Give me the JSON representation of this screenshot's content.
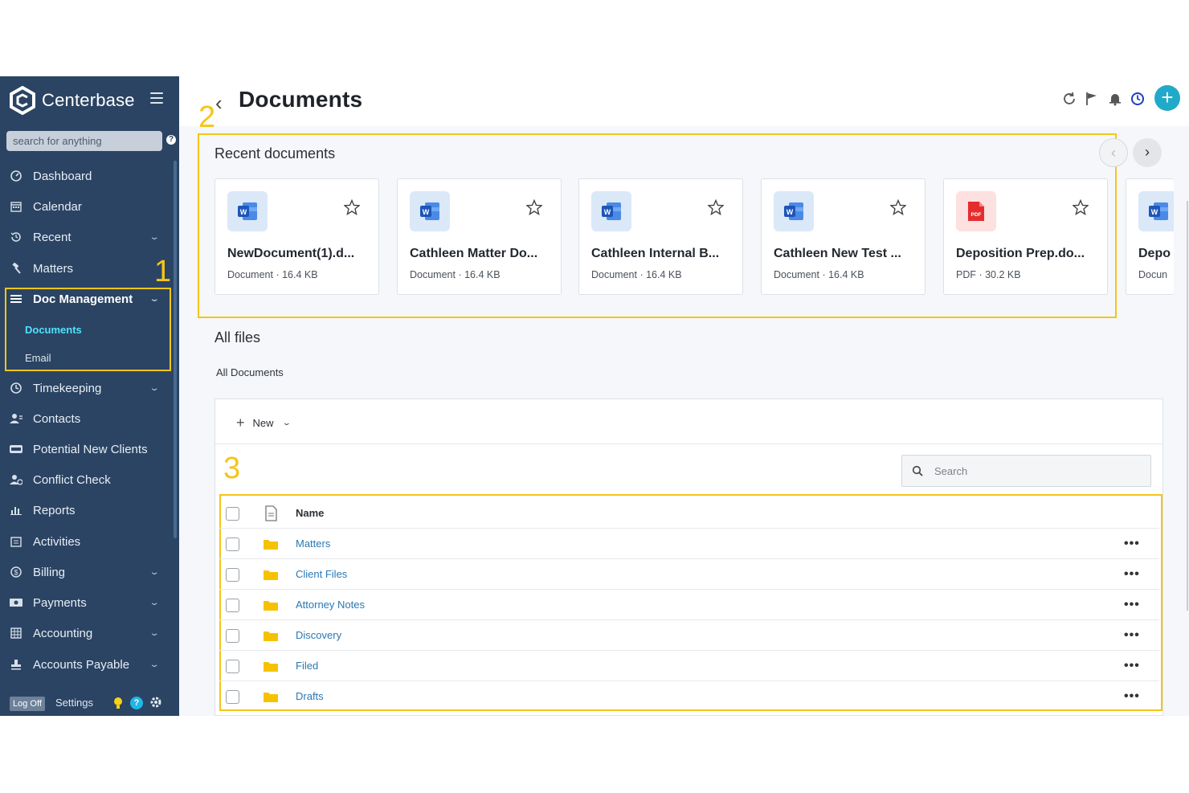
{
  "sidebar": {
    "brand": "Centerbase",
    "search_placeholder": "search for anything",
    "help": "?",
    "items": [
      {
        "label": "Dashboard",
        "icon": "dashboard-icon",
        "has_chevron": false
      },
      {
        "label": "Calendar",
        "icon": "calendar-icon",
        "has_chevron": false
      },
      {
        "label": "Recent",
        "icon": "history-icon",
        "has_chevron": true
      },
      {
        "label": "Matters",
        "icon": "gavel-icon",
        "has_chevron": false
      },
      {
        "label": "Doc Management",
        "icon": "list-icon",
        "has_chevron": true,
        "active": true
      },
      {
        "label": "Timekeeping",
        "icon": "clock-icon",
        "has_chevron": true
      },
      {
        "label": "Contacts",
        "icon": "contacts-icon",
        "has_chevron": false
      },
      {
        "label": "Potential New Clients",
        "icon": "new-badge-icon",
        "has_chevron": false
      },
      {
        "label": "Conflict Check",
        "icon": "conflict-icon",
        "has_chevron": false
      },
      {
        "label": "Reports",
        "icon": "chart-icon",
        "has_chevron": false
      },
      {
        "label": "Activities",
        "icon": "activities-icon",
        "has_chevron": false
      },
      {
        "label": "Billing",
        "icon": "billing-icon",
        "has_chevron": true
      },
      {
        "label": "Payments",
        "icon": "payments-icon",
        "has_chevron": true
      },
      {
        "label": "Accounting",
        "icon": "ledger-icon",
        "has_chevron": true
      },
      {
        "label": "Accounts Payable",
        "icon": "stamp-icon",
        "has_chevron": true
      }
    ],
    "sub_items": [
      {
        "label": "Documents",
        "current": true
      },
      {
        "label": "Email",
        "current": false
      }
    ],
    "footer": {
      "logoff": "Log Off",
      "settings": "Settings",
      "help": "?"
    }
  },
  "markers": {
    "one": "1",
    "two": "2",
    "three": "3"
  },
  "header": {
    "title": "Documents"
  },
  "recent": {
    "title": "Recent documents",
    "cards": [
      {
        "name": "NewDocument(1).d...",
        "meta": "Document · 16.4 KB",
        "type": "word"
      },
      {
        "name": "Cathleen Matter Do...",
        "meta": "Document · 16.4 KB",
        "type": "word"
      },
      {
        "name": "Cathleen Internal B...",
        "meta": "Document · 16.4 KB",
        "type": "word"
      },
      {
        "name": "Cathleen New Test ...",
        "meta": "Document · 16.4 KB",
        "type": "word"
      },
      {
        "name": "Deposition Prep.do...",
        "meta": "PDF · 30.2 KB",
        "type": "pdf"
      },
      {
        "name": "Depo",
        "meta": "Docun",
        "type": "word"
      }
    ]
  },
  "files": {
    "title": "All files",
    "breadcrumb": "All Documents",
    "new_label": "New",
    "search_placeholder": "Search",
    "column_name": "Name",
    "rows": [
      {
        "name": "Matters"
      },
      {
        "name": "Client Files"
      },
      {
        "name": "Attorney Notes"
      },
      {
        "name": "Discovery"
      },
      {
        "name": "Filed"
      },
      {
        "name": "Drafts"
      }
    ]
  },
  "colors": {
    "sidebar_bg": "#2b4463",
    "accent": "#21a9c9",
    "highlight": "#f5c518",
    "link": "#2a78b3",
    "folder": "#f6c200",
    "current_sub": "#4fe2ff"
  }
}
